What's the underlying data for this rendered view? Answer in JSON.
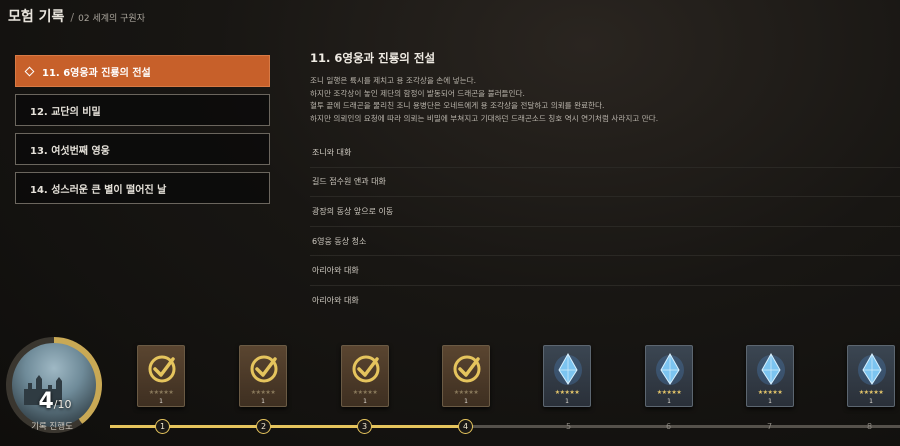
{
  "header": {
    "title": "모험 기록",
    "separator": "/",
    "subtitle": "02 세계의 구원자"
  },
  "chapters": [
    {
      "label": "11. 6영웅과 진룡의 전설",
      "active": true
    },
    {
      "label": "12. 교단의 비밀",
      "active": false
    },
    {
      "label": "13. 여섯번째 영웅",
      "active": false
    },
    {
      "label": "14. 성스러운 큰 별이 떨어진 날",
      "active": false
    }
  ],
  "detail": {
    "title": "11. 6영웅과 진룡의 전설",
    "description": [
      "조니 일행은 륙시를 제치고 용 조각상을 손에 넣는다.",
      "하지만 조각상이 놓인 제단의 함정이 발동되어 드래곤을 불러들인다.",
      "혈투 끝에 드래곤을 물리친 조니 용병단은 오네트에게 용 조각상을 전달하고 의뢰를 완료한다.",
      "하지만 의뢰인의 요청에 따라 의뢰는 비밀에 부쳐지고 기대하던 드래곤소드 칭호 역시 연기처럼 사라지고 만다."
    ]
  },
  "tasks": [
    "조니와 대화",
    "길드 접수원 앤과 대화",
    "광장의 동상 앞으로 이동",
    "6영웅 동상 청소",
    "아리아와 대화",
    "아리아와 대화"
  ],
  "progress": {
    "current": "4",
    "total": "/10",
    "label": "기록 진행도",
    "fraction": 0.4
  },
  "rewards": [
    {
      "type": "check-icon",
      "qty": "1",
      "stars": "★★★★★"
    },
    {
      "type": "check-icon",
      "qty": "1",
      "stars": "★★★★★"
    },
    {
      "type": "check-icon",
      "qty": "1",
      "stars": "★★★★★"
    },
    {
      "type": "check-icon",
      "qty": "1",
      "stars": "★★★★★"
    },
    {
      "type": "crystal-icon",
      "qty": "1",
      "stars": "★★★★★"
    },
    {
      "type": "crystal-icon",
      "qty": "1",
      "stars": "★★★★★"
    },
    {
      "type": "crystal-icon",
      "qty": "1",
      "stars": "★★★★★"
    },
    {
      "type": "crystal-icon",
      "qty": "1",
      "stars": "★★★★★"
    }
  ],
  "track": {
    "nodes": [
      "1",
      "2",
      "3",
      "4",
      "5",
      "6",
      "7",
      "8"
    ],
    "completed": 4
  },
  "colors": {
    "accent": "#c7602a",
    "gold": "#e5c45d",
    "panel": "#0f0e0c"
  }
}
